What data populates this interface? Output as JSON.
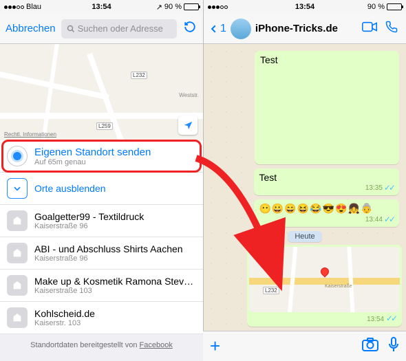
{
  "status": {
    "carrier": "Blau",
    "time": "13:54",
    "batteryPercent": "90 %",
    "locGlyph": "↗"
  },
  "left": {
    "cancel": "Abbrechen",
    "searchPlaceholder": "Suchen oder Adresse",
    "roadLabels": {
      "a": "L232",
      "b": "L259",
      "c": "Weststr."
    },
    "legal": "Rechtl. Informationen",
    "sendOwn": {
      "title": "Eigenen Standort senden",
      "sub": "Auf 65m genau"
    },
    "hide": "Orte ausblenden",
    "places": [
      {
        "title": "Goalgetter99 - Textildruck",
        "sub": "Kaiserstraße 96"
      },
      {
        "title": "ABI - und Abschluss Shirts Aachen",
        "sub": "Kaiserstraße 96"
      },
      {
        "title": "Make up & Kosmetik Ramona Steves -...",
        "sub": "Kaiserstraße 103"
      },
      {
        "title": "Kohlscheid.de",
        "sub": "Kaiserstr. 103"
      }
    ],
    "footerPrefix": "Standortdaten bereitgestellt von ",
    "footerLink": "Facebook"
  },
  "right": {
    "backCount": "1",
    "contact": "iPhone-Tricks.de",
    "msg1": {
      "text": "Test",
      "time": ""
    },
    "msg2": {
      "text": "Test",
      "time": "13:35"
    },
    "emojiRow": "😶😀😄😆😂😎😍👧👵",
    "emojiTime": "13:44",
    "dateChip": "Heute",
    "mapLabel": "L232",
    "mapRoad": "Kaiserstraße",
    "mapTime": "13:54"
  }
}
